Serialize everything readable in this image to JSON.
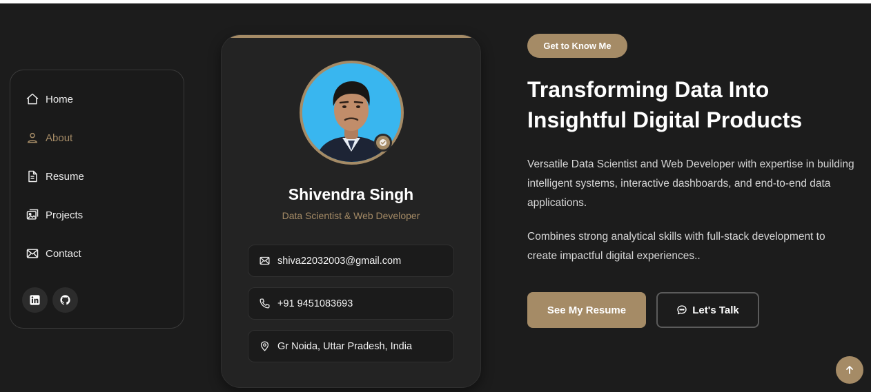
{
  "nav": {
    "items": [
      {
        "label": "Home",
        "icon": "home-icon"
      },
      {
        "label": "About",
        "icon": "user-icon",
        "active": true
      },
      {
        "label": "Resume",
        "icon": "document-icon"
      },
      {
        "label": "Projects",
        "icon": "gallery-icon"
      },
      {
        "label": "Contact",
        "icon": "envelope-icon"
      }
    ],
    "social": [
      "linkedin-icon",
      "github-icon"
    ]
  },
  "profile": {
    "name": "Shivendra Singh",
    "role": "Data Scientist & Web Developer",
    "email": "shiva22032003@gmail.com",
    "phone": "+91 9451083693",
    "location": "Gr Noida, Uttar Pradesh, India"
  },
  "about": {
    "chip": "Get to Know Me",
    "headline_line1": "Transforming Data Into",
    "headline_line2": "Insightful Digital Products",
    "para1": "Versatile Data Scientist and Web Developer with expertise in building intelligent systems, interactive dashboards, and end-to-end data applications.",
    "para2": "Combines strong analytical skills with full-stack development to create impactful digital experiences..",
    "btn_resume": "See My Resume",
    "btn_talk": "Let's Talk"
  },
  "colors": {
    "accent": "#a58b66",
    "background": "#1c1c1c",
    "card": "#232323"
  }
}
